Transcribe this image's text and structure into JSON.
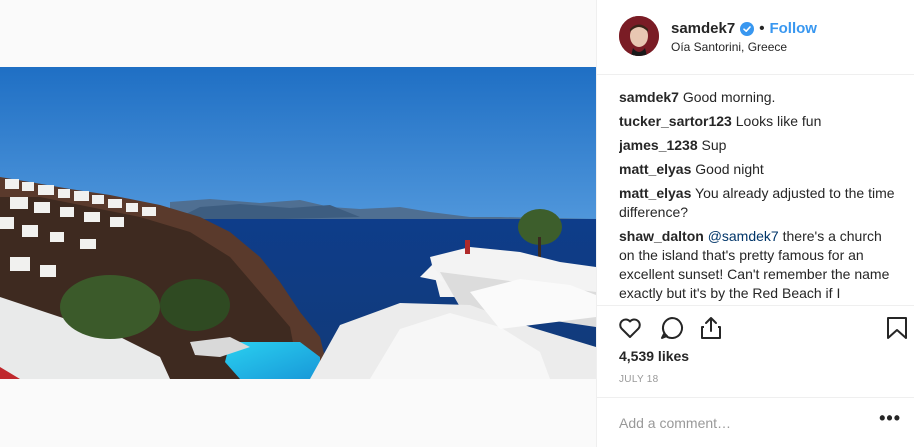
{
  "post": {
    "username": "samdek7",
    "separator": "•",
    "follow_label": "Follow",
    "location": "Oía Santorini, Greece",
    "likes": "4,539 likes",
    "date": "JULY 18",
    "comment_placeholder": "Add a comment…",
    "more_label": "•••"
  },
  "comments": [
    {
      "user": "samdek7",
      "text": "Good morning."
    },
    {
      "user": "tucker_sartor123",
      "text": "Looks like fun"
    },
    {
      "user": "james_1238",
      "text": "Sup"
    },
    {
      "user": "matt_elyas",
      "text": "Good night"
    },
    {
      "user": "matt_elyas",
      "text": "You already adjusted to the time difference?"
    },
    {
      "user": "shaw_dalton",
      "mention": "@samdek7",
      "text": "there's a church on the island that's pretty famous for an excellent sunset! Can't remember the name exactly but it's by the Red Beach if I remember right! Try that one!"
    }
  ],
  "icons": {
    "verified": "verified-badge-icon",
    "like": "heart-icon",
    "comment": "comment-bubble-icon",
    "share": "share-icon",
    "save": "bookmark-icon"
  },
  "colors": {
    "link_blue": "#3897f0",
    "avatar": "#7a1c25"
  }
}
